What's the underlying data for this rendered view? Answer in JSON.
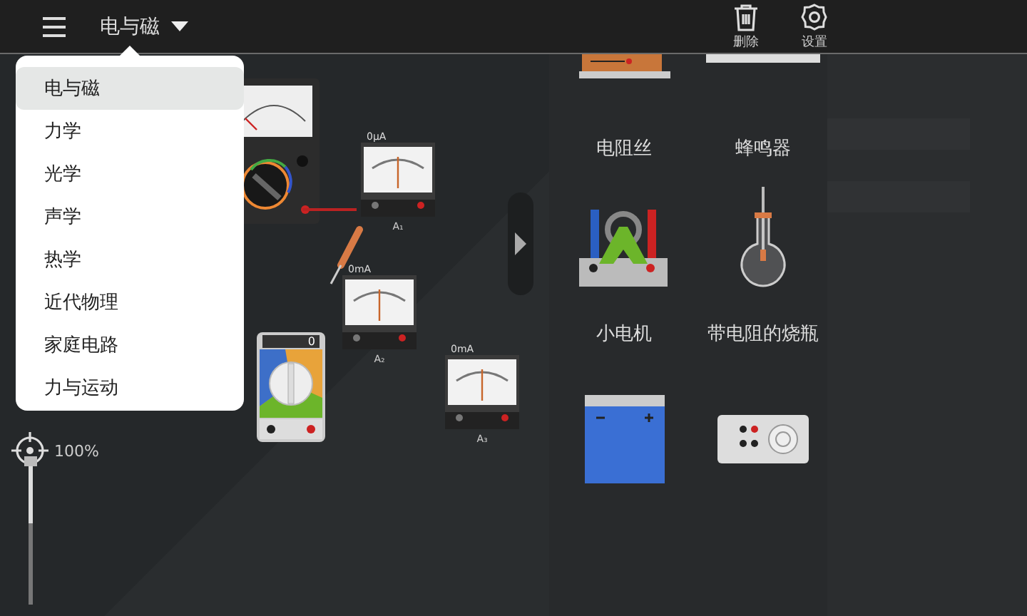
{
  "toolbar": {
    "category": "电与磁",
    "actions": [
      {
        "kind": "delete",
        "label": "删除"
      },
      {
        "kind": "settings",
        "label": "设置"
      }
    ]
  },
  "category_menu": {
    "items": [
      {
        "label": "电与磁",
        "selected": true
      },
      {
        "label": "力学",
        "selected": false
      },
      {
        "label": "光学",
        "selected": false
      },
      {
        "label": "声学",
        "selected": false
      },
      {
        "label": "热学",
        "selected": false
      },
      {
        "label": "近代物理",
        "selected": false
      },
      {
        "label": "家庭电路",
        "selected": false
      },
      {
        "label": "力与运动",
        "selected": false
      }
    ]
  },
  "canvas": {
    "meters": [
      {
        "reading": "0μA",
        "label": "A₁"
      },
      {
        "reading": "0mA",
        "label": "A₂"
      },
      {
        "reading": "0mA",
        "label": "A₃"
      }
    ],
    "digital_meter_display": "0"
  },
  "zoom": {
    "reading": "100%",
    "level": 0.45
  },
  "palette": {
    "items": [
      {
        "kind": "resistance-wire",
        "label": "电阻丝"
      },
      {
        "kind": "buzzer",
        "label": "蜂鸣器"
      },
      {
        "kind": "motor",
        "label": "小电机"
      },
      {
        "kind": "flask",
        "label": "带电阻的烧瓶"
      },
      {
        "kind": "battery"
      },
      {
        "kind": "resistance-box"
      }
    ]
  }
}
